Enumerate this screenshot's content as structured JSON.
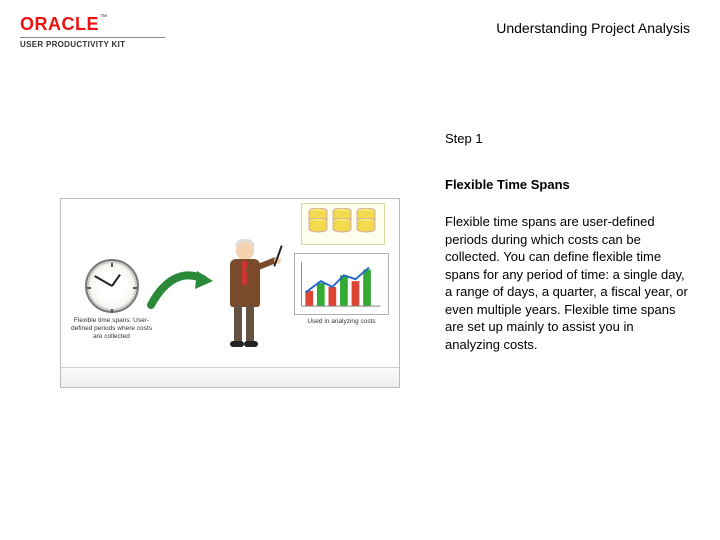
{
  "header": {
    "brand_word": "ORACLE",
    "trademark": "™",
    "product_line": "USER PRODUCTIVITY KIT",
    "page_title": "Understanding Project Analysis"
  },
  "illustration": {
    "clock_caption": "Flexible time spans: User-defined periods where costs are collected",
    "chart_caption": "Used in analyzing costs"
  },
  "content": {
    "step_label": "Step 1",
    "section_title": "Flexible Time Spans",
    "body": "Flexible time spans are user-defined periods during which costs can be collected. You can define flexible time spans for any period of time: a single day, a range of days, a quarter, a fiscal year, or even multiple years. Flexible time spans are set up mainly to assist you in analyzing costs."
  }
}
